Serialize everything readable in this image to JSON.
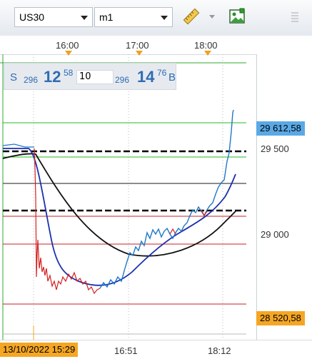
{
  "toolbar": {
    "symbol": "US30",
    "timeframe": "m1",
    "ruler_icon": "ruler-icon",
    "screenshot_icon": "picture-icon",
    "menu_icon": "menu-icon"
  },
  "time_axis": {
    "labels": [
      "16:00",
      "17:00",
      "18:00"
    ]
  },
  "quote_panel": {
    "sell_label": "S",
    "sell_prefix": "296",
    "sell_big": "12",
    "sell_sup": "58",
    "lot": "10",
    "buy_prefix": "296",
    "buy_big": "14",
    "buy_sup": "76",
    "buy_label": "B"
  },
  "price_axis": {
    "labels": [
      "29 500",
      "29 000"
    ],
    "current_price": "29 612,58",
    "marker_price": "28 520,58"
  },
  "bottom_axis": {
    "crosshair_datetime": "13/10/2022 15:29",
    "labels": [
      "16:51",
      "18:12"
    ]
  },
  "colors": {
    "accent_blue": "#5aa9e6",
    "marker_orange": "#f5a623",
    "price_up": "#1f78c8",
    "price_down": "#d42020",
    "ma_fast": "#1a2fb0",
    "ma_slow": "#111111",
    "level_green": "#22bb22",
    "level_red": "#c82020"
  }
}
